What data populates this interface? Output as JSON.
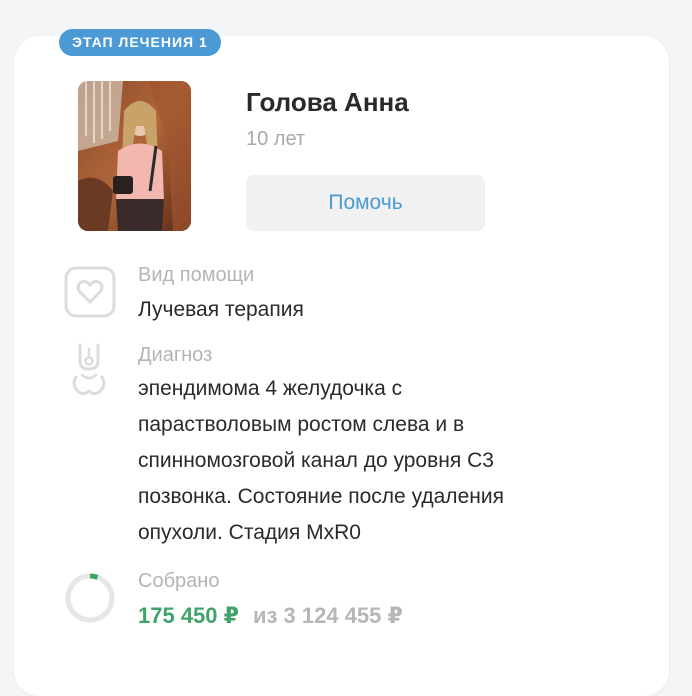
{
  "badge": {
    "label": "ЭТАП ЛЕЧЕНИЯ 1"
  },
  "patient": {
    "name": "Голова Анна",
    "age": "10 лет"
  },
  "help_button": {
    "label": "Помочь"
  },
  "help_type": {
    "label": "Вид помощи",
    "value": "Лучевая терапия"
  },
  "diagnosis": {
    "label": "Диагноз",
    "lines": [
      "эпендимома 4 желудочка с",
      "парастволовым ростом слева и в",
      "спинномозговой канал до уровня С3",
      "позвонка. Состояние после удаления",
      "опухоли. Стадия MxR0"
    ]
  },
  "collected": {
    "label": "Собрано",
    "amount": "175 450 ₽",
    "total": "из 3 124 455 ₽",
    "progress_fraction": 0.056
  },
  "colors": {
    "accent": "#4b9ad6",
    "collected": "#3fa46a",
    "muted": "#b4b4b4",
    "text": "#2a2a2a"
  }
}
